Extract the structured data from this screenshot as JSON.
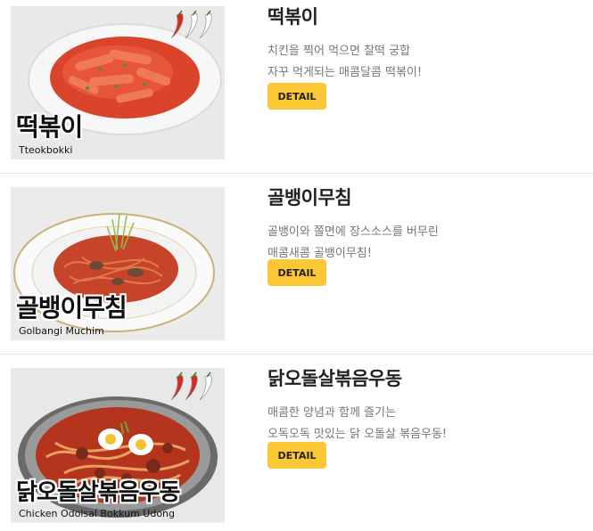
{
  "menu": [
    {
      "name_ko": "떡볶이",
      "name_en": "Tteokbokki",
      "title": "떡볶이",
      "desc": [
        "치킨을 찍어 먹으면 찰떡 궁합",
        "자꾸 먹게되는 매콤달콤 떡볶이!"
      ],
      "button_label": "DETAIL",
      "spice_level": 1,
      "spice_max": 3
    },
    {
      "name_ko": "골뱅이무침",
      "name_en": "Golbangi Muchim",
      "title": "골뱅이무침",
      "desc": [
        "골뱅이와 쫄면에 장스소스를 버무린",
        "매콤새콤 골뱅이무침!"
      ],
      "button_label": "DETAIL",
      "spice_level": 0,
      "spice_max": 0
    },
    {
      "name_ko": "닭오돌살볶음우동",
      "name_en": "Chicken Odolsal Bokkum Udong",
      "title": "닭오돌살볶음우동",
      "desc": [
        "매콤한 양념과 함께 즐기는",
        "오독오독 맛있는 닭 오돌살 볶음우동!"
      ],
      "button_label": "DETAIL",
      "spice_level": 2,
      "spice_max": 3
    }
  ],
  "colors": {
    "button": "#fcc735",
    "pepper_red": "#d42a1c",
    "pepper_off": "#ffffff"
  }
}
